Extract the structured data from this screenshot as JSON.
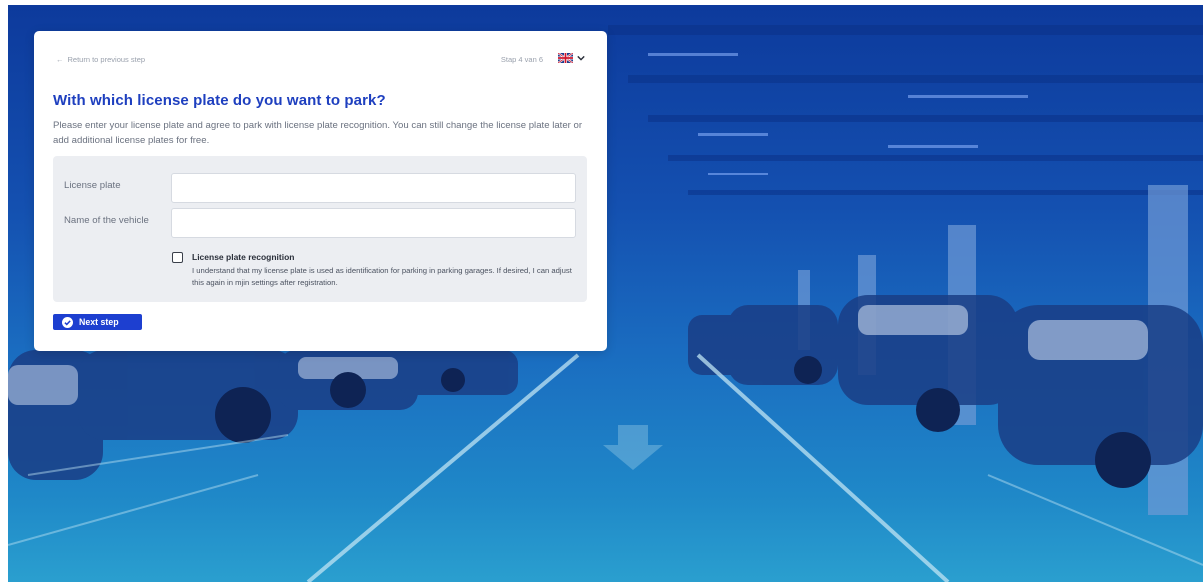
{
  "background": {
    "image": "parking-garage-photo",
    "tint": "#1450b0"
  },
  "header": {
    "back_label": "Return to previous step",
    "step_indicator": "Stap 4 van 6",
    "language_flag": "uk-flag-icon"
  },
  "page": {
    "title": "With which license plate do you want to park?",
    "intro": "Please enter your license plate and agree to park with license plate recognition. You can still change the license plate later or add additional license plates for free."
  },
  "form": {
    "license_plate": {
      "label": "License plate",
      "value": "",
      "placeholder": ""
    },
    "vehicle_name": {
      "label": "Name of the vehicle",
      "value": "",
      "placeholder": ""
    },
    "recognition": {
      "title": "License plate recognition",
      "description": "I understand that my license plate is used as identification for parking in parking garages. If desired, I can adjust this again in mjin settings after registration.",
      "checked": false
    }
  },
  "actions": {
    "next_label": "Next step"
  },
  "colors": {
    "accent": "#1d3fd0",
    "title": "#1e3fbf",
    "form_bg": "#eceef2"
  }
}
